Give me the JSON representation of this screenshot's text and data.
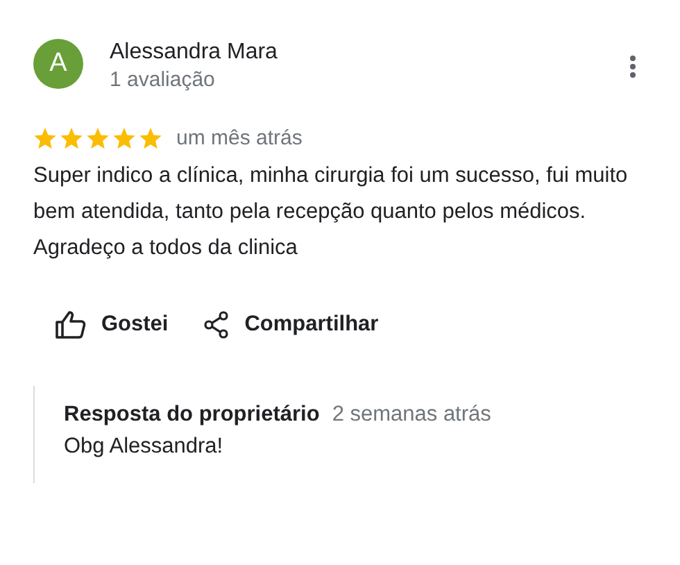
{
  "review": {
    "avatar_letter": "A",
    "author": "Alessandra Mara",
    "author_meta": "1 avaliação",
    "stars": 5,
    "date": "um mês atrás",
    "paragraphs": [
      "Super indico a clínica, minha cirurgia foi um sucesso, fui muito bem atendida, tanto pela recepção quanto pelos médicos.",
      "Agradeço a todos da clinica"
    ]
  },
  "actions": [
    {
      "kind": "like",
      "label": "Gostei"
    },
    {
      "kind": "share",
      "label": "Compartilhar"
    }
  ],
  "owner_reply": {
    "title": "Resposta do proprietário",
    "date": "2 semanas atrás",
    "text": "Obg Alessandra!"
  }
}
